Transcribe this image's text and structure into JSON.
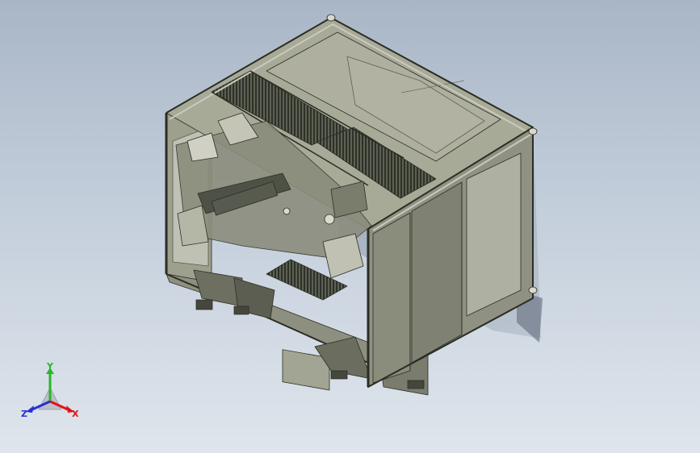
{
  "viewport": {
    "model": "frame-machine-assembly",
    "background_top": "#a9b6c6",
    "background_bottom": "#dfe5ec"
  },
  "triad": {
    "x_label": "X",
    "y_label": "Y",
    "z_label": "Z",
    "x_color": "#e0141a",
    "y_color": "#2ab52a",
    "z_color": "#2430d8"
  }
}
